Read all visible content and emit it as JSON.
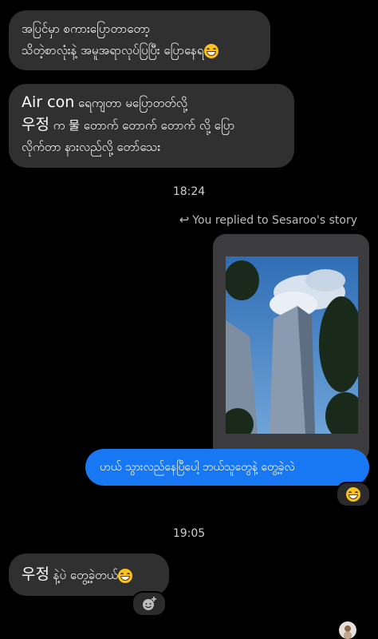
{
  "messages": {
    "m1": {
      "line1": "အပြင်မှာ စကားပြောတာတော့",
      "line2": "သိတဲ့စာလုံးနဲ့ အမူအရာလုပ်ပြပြီး ပြောနေရ",
      "emoji": "grinning-face"
    },
    "m2": {
      "line1_big": "Air con",
      "line1_rest": " ရေကျတာ မပြောတတ်လို့",
      "line2_big": "우정",
      "line2_rest": " က 물 တောက် တောက် တောက် လို့ ပြော",
      "line3": "လိုက်တာ နားလည်လို့ တော်သေး"
    },
    "m3": {
      "text": "ဟယ် သွားလည်နေပြီပေါ့ ဘယ်သူတွေနဲ့ တွေ့ခဲ့လဲ"
    },
    "m4": {
      "big": "우정",
      "rest": " နဲ့ပဲ တွေ့ခဲ့တယ်",
      "emoji": "grinning-face"
    }
  },
  "timestamps": {
    "t1": "18:24",
    "t2": "19:05"
  },
  "reply_note": {
    "text": "You replied to Sesaroo's story"
  },
  "reactions": {
    "r1": "grinning-face",
    "r2": "add-reaction"
  },
  "colors": {
    "incoming": "#303030",
    "outgoing": "#1877f2",
    "background": "#000000"
  }
}
